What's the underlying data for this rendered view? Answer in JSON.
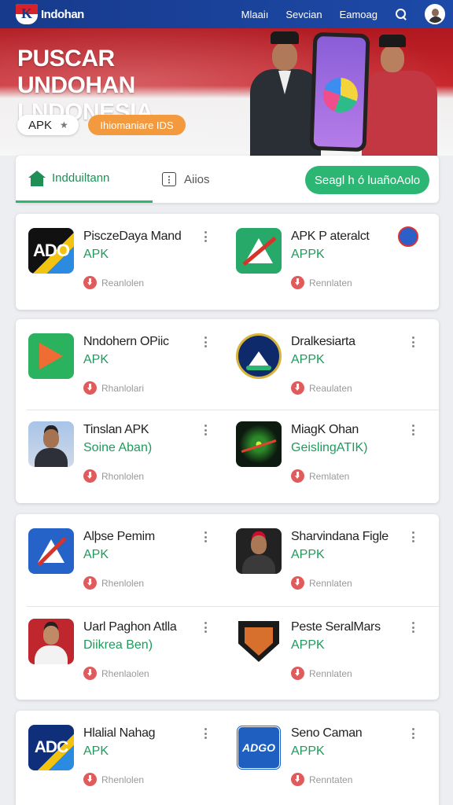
{
  "header": {
    "brand": "Indohan",
    "nav": [
      "Mlaaiı",
      "Sevcian",
      "Eamoag"
    ]
  },
  "hero": {
    "title": "PUSCAR UNDOHAN LNDONESIA",
    "pill_apk": "APK",
    "pill_info": "Ihiomaniare IDS"
  },
  "tabs": {
    "tab1": "Indduiltann",
    "tab2": "Aiios",
    "cta": "Seagl h ó luañoAolo"
  },
  "apps": [
    {
      "name": "PisczeDaya Mand",
      "sub": "APK",
      "meta": "Reanlolen",
      "icon": "ado-logo-icon",
      "icon_text": "ADO"
    },
    {
      "name": "APK P ateralct",
      "sub": "APPK",
      "meta": "Rennlaten",
      "icon": "green-a-icon"
    },
    {
      "name": "Nndohern OPiic",
      "sub": "APK",
      "meta": "Rhanlolari",
      "icon": "green-play-icon"
    },
    {
      "name": "Dralkesiarta",
      "sub": "APPK",
      "meta": "Reaulaten",
      "icon": "seal-emblem-icon"
    },
    {
      "name": "Tinslan APK",
      "sub": "Soine Aban)",
      "meta": "Rhonlolen",
      "icon": "person-photo-icon"
    },
    {
      "name": "MiagK Ohan",
      "sub": "GeislingATIK)",
      "meta": "Remlaten",
      "icon": "burst-logo-icon"
    },
    {
      "name": "Alþse Pemim",
      "sub": "APK",
      "meta": "Rhenlolen",
      "icon": "blue-a-icon"
    },
    {
      "name": "Sharvindana Figle",
      "sub": "APPK",
      "meta": "Rennlaten",
      "icon": "person-dark-icon"
    },
    {
      "name": "Uarl Paghon Atlla",
      "sub": "Diikrea Ben)",
      "meta": "Rhenlaolen",
      "icon": "person-red-icon"
    },
    {
      "name": "Peste SeralMars",
      "sub": "APPK",
      "meta": "Rennlaten",
      "icon": "shield-crest-icon"
    },
    {
      "name": "Hlalial Nahag",
      "sub": "APK",
      "meta": "Rhenlolen",
      "icon": "adc-logo-icon",
      "icon_text": "ADC"
    },
    {
      "name": "Seno Caman",
      "sub": "APPK",
      "meta": "Renntaten",
      "icon": "stamp-logo-icon",
      "icon_text": "ADGO"
    }
  ]
}
